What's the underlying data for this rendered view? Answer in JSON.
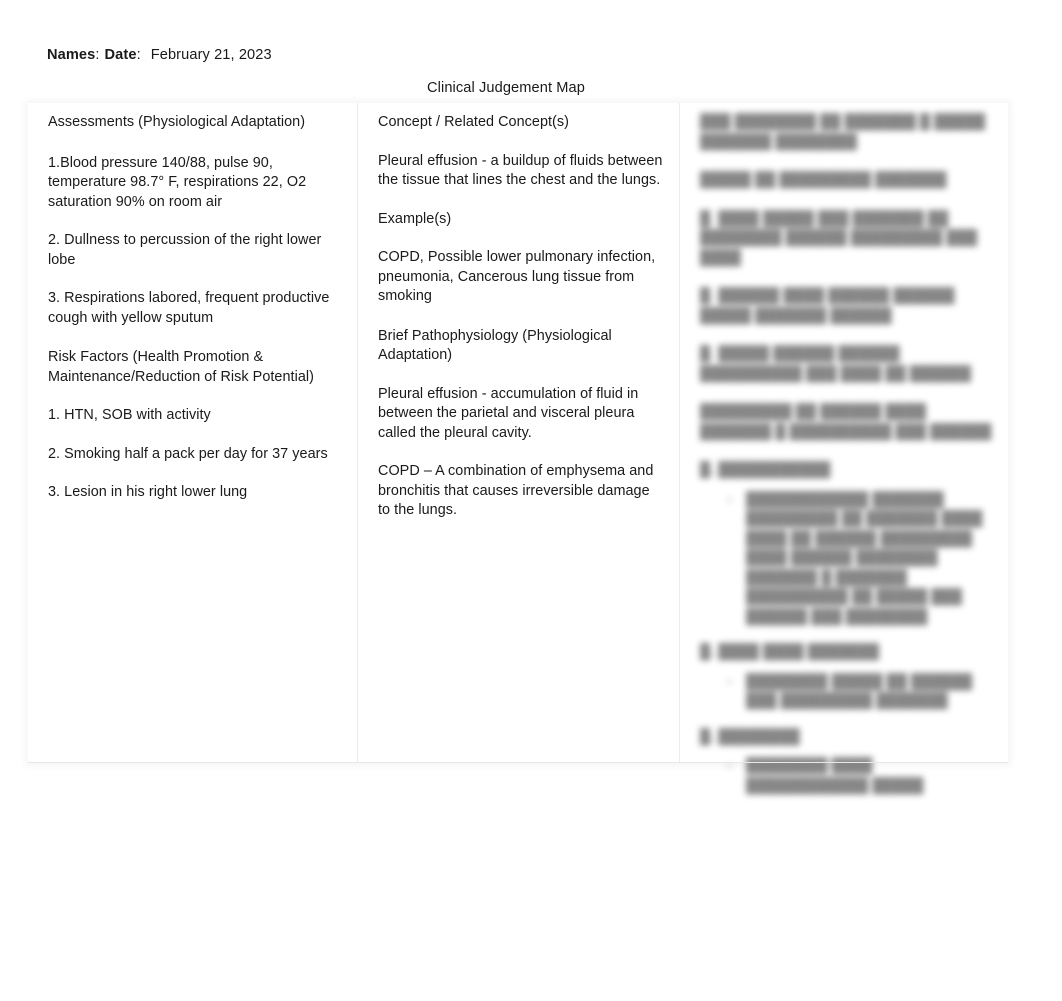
{
  "header": {
    "names_label": "Names",
    "date_label": "Date",
    "colon": ":",
    "date_value": "February 21, 2023",
    "title": "Clinical Judgement Map"
  },
  "table": {
    "columns": [
      {
        "id": "assessments",
        "heading": "Assessments (Physiological Adaptation)",
        "items": [
          "1.Blood pressure 140/88, pulse 90, temperature 98.7° F, respirations 22, O2 saturation 90% on room air",
          "2. Dullness to percussion of the right lower lobe",
          "3. Respirations labored, frequent productive cough with yellow sputum"
        ],
        "subheading": "Risk Factors (Health Promotion & Maintenance/Reduction of Risk Potential)",
        "sub_items": [
          "1. HTN, SOB with activity",
          "2. Smoking half a pack per day for 37 years",
          "3. Lesion in his right lower lung"
        ]
      },
      {
        "id": "concepts",
        "heading": "Concept / Related Concept(s)",
        "items": [
          "Pleural effusion - a buildup of fluids between the tissue that lines the chest and the lungs.",
          "Example(s)",
          "COPD, Possible lower pulmonary infection, pneumonia, Cancerous lung tissue from smoking"
        ],
        "subheading": "Brief Pathophysiology (Physiological Adaptation)",
        "sub_items": [
          "Pleural effusion - accumulation of fluid in between the parietal and visceral pleura called the pleural cavity.",
          "COPD – A combination of emphysema and bronchitis that causes irreversible damage to the lungs."
        ]
      },
      {
        "id": "redacted",
        "heading": "███ ████████ ██ ███████ █ █████ ███████ ████████",
        "heading_line2": "█████ ██ █████████ ███████",
        "items": [
          "█. ████ █████ ███ ███████ ██ ████████ ██████ █████████ ███ ████",
          "█. ██████ ████ ██████ ██████ █████ ███████ ██████",
          "█. █████ ██████ ██████ ██████████ ███ ████ ██ ██████"
        ],
        "sub_heading": "█████████ ██ ██████ ████ ███████ █ ██████████ ███ ██████",
        "groups": [
          {
            "label": "█. ███████████",
            "bullets": [
              "████████████ ███████ █████████ ██ ███████ ████ ████ ██ ██████ █████████ ████ ██████ ████████ ███████ █ ███████ ██████████ ██ █████ ███ ██████ ███ ████████"
            ]
          },
          {
            "label": "█. ████ ████ ███████",
            "bullets": [
              "████████ █████ ██ ██████ ███ █████████ ███████"
            ]
          },
          {
            "label": "█. ████████",
            "bullets": [
              "████████ ████ ████████████ █████"
            ]
          }
        ]
      }
    ]
  }
}
